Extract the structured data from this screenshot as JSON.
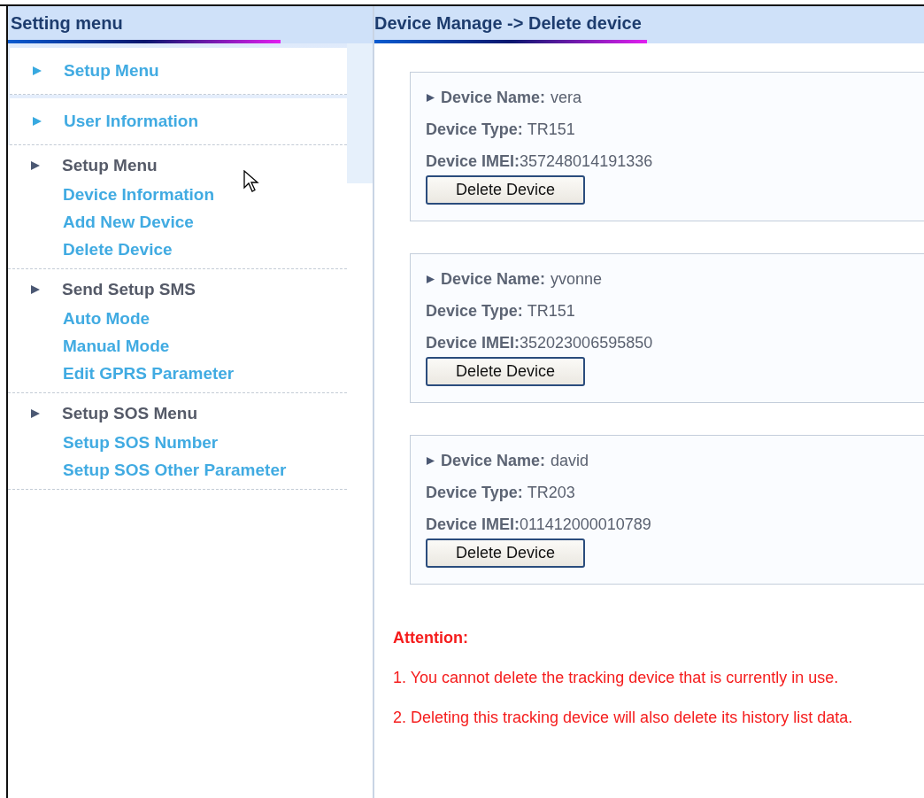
{
  "sidebar": {
    "title": "Setting menu",
    "groups": [
      {
        "title": "Setup Menu",
        "expanded": false
      },
      {
        "title": "User Information",
        "expanded": false
      },
      {
        "title": "Setup Menu",
        "expanded": true,
        "children": [
          {
            "label": "Device Information"
          },
          {
            "label": "Add New Device"
          },
          {
            "label": "Delete Device"
          }
        ]
      },
      {
        "title": "Send Setup SMS",
        "expanded": true,
        "children": [
          {
            "label": "Auto Mode"
          },
          {
            "label": "Manual Mode"
          },
          {
            "label": "Edit GPRS Parameter"
          }
        ]
      },
      {
        "title": "Setup SOS Menu",
        "expanded": true,
        "children": [
          {
            "label": "Setup SOS Number"
          },
          {
            "label": "Setup SOS Other Parameter"
          }
        ]
      }
    ]
  },
  "main": {
    "title": "Device Manage -> Delete device",
    "devices": [
      {
        "name_label": "Device Name:",
        "name": "vera",
        "type_label": "Device Type:",
        "type": "TR151",
        "imei_label": "Device IMEI:",
        "imei": "357248014191336",
        "button": "Delete Device"
      },
      {
        "name_label": "Device Name:",
        "name": "yvonne",
        "type_label": "Device Type:",
        "type": "TR151",
        "imei_label": "Device IMEI:",
        "imei": "352023006595850",
        "button": "Delete Device"
      },
      {
        "name_label": "Device Name:",
        "name": "david",
        "type_label": "Device Type:",
        "type": "TR203",
        "imei_label": "Device IMEI:",
        "imei": "011412000010789",
        "button": "Delete Device"
      }
    ],
    "attention": {
      "title": "Attention:",
      "notes": [
        "1. You cannot delete the tracking device that is currently in use.",
        "2. Deleting this tracking device will also delete its history list data."
      ]
    }
  }
}
